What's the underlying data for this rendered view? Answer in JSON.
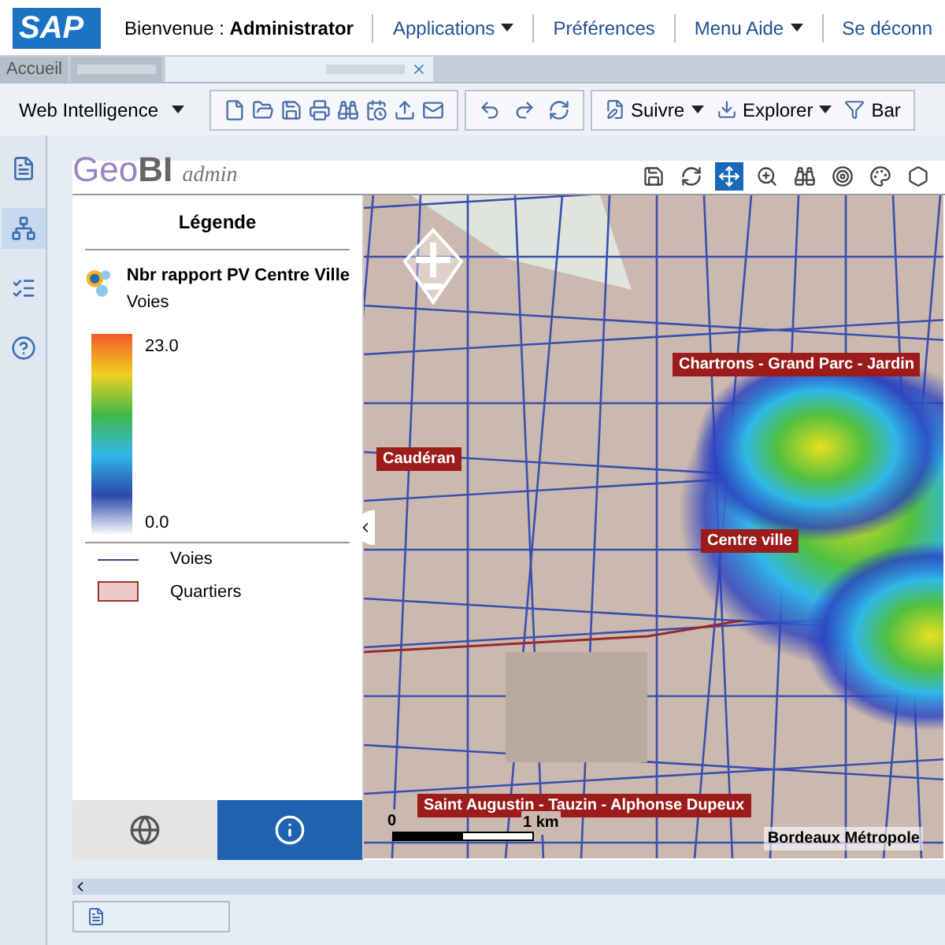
{
  "header": {
    "logo": "SAP",
    "welcome": "Bienvenue :",
    "user": "Administrator",
    "links": [
      {
        "label": "Applications",
        "dropdown": true
      },
      {
        "label": "Préférences",
        "dropdown": false
      },
      {
        "label": "Menu Aide",
        "dropdown": true
      },
      {
        "label": "Se déconn",
        "dropdown": false
      }
    ]
  },
  "tabs": [
    {
      "label": "Accueil",
      "selected": false,
      "closable": false
    },
    {
      "selected": false,
      "closable": false
    },
    {
      "selected": true,
      "closable": true
    }
  ],
  "toolbar": {
    "app": "Web Intelligence",
    "actions": [
      {
        "kind": "track",
        "label": "Suivre"
      },
      {
        "kind": "drill",
        "label": "Explorer"
      },
      {
        "kind": "filter",
        "label": "Bar"
      }
    ]
  },
  "sidebar": [
    {
      "kind": "document",
      "selected": false
    },
    {
      "kind": "tree",
      "selected": true
    },
    {
      "kind": "checklist",
      "selected": false
    },
    {
      "kind": "help",
      "selected": false
    }
  ],
  "geobi": {
    "brand_a": "Geo",
    "brand_b": "BI",
    "brand_c": "admin",
    "tools": [
      {
        "kind": "save",
        "selected": false
      },
      {
        "kind": "refresh",
        "selected": false
      },
      {
        "kind": "pan",
        "selected": true
      },
      {
        "kind": "zoom",
        "selected": false
      },
      {
        "kind": "find",
        "selected": false
      },
      {
        "kind": "target",
        "selected": false
      },
      {
        "kind": "palette",
        "selected": false
      },
      {
        "kind": "web",
        "selected": false
      }
    ]
  },
  "legend": {
    "title": "Légende",
    "layer": "Nbr rapport PV Centre Ville",
    "sublayer": "Voies",
    "max": "23.0",
    "min": "0.0",
    "items": [
      {
        "kind": "line",
        "label": "Voies"
      },
      {
        "kind": "area",
        "label": "Quartiers"
      }
    ],
    "tabs": [
      {
        "kind": "map",
        "selected": false
      },
      {
        "kind": "info",
        "selected": true
      }
    ]
  },
  "map": {
    "labels": [
      "Chartrons - Grand Parc - Jardin",
      "Caudéran",
      "Centre ville",
      "Saint Augustin - Tauzin - Alphonse Dupeux"
    ],
    "scale_start": "0",
    "scale_end": "1 km",
    "attribution": "Bordeaux Métropole"
  }
}
